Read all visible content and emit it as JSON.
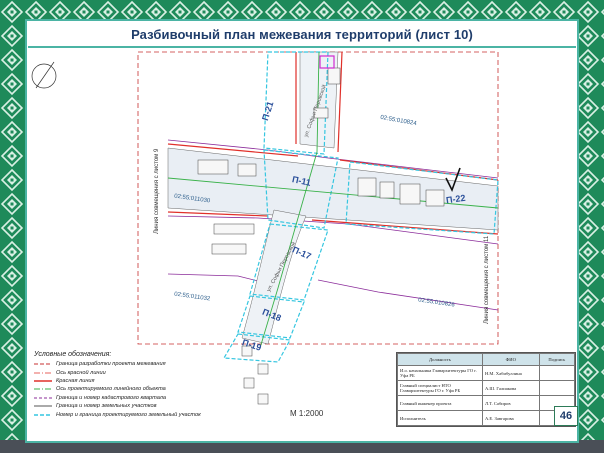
{
  "title": "Разбивочный план межевания территорий (лист 10)",
  "page_number": "46",
  "scale": "М 1:2000",
  "colors": {
    "frame_green": "#1e8a5a",
    "accent_teal": "#4bb4a4",
    "title_text": "#1f3d6b",
    "red_line": "#e0302a",
    "plot_cyan": "#35c6e0",
    "cadastre_purple": "#8b2c9a"
  },
  "side_labels": {
    "left": "Линия совмещения с листом 9",
    "right": "Линия совмещения с листом 11"
  },
  "cadastral_blocks": [
    "02:55:010824",
    "02:55:011030",
    "02:55:011032",
    "02:55:010826"
  ],
  "plots": [
    "П-21",
    "П-11",
    "П-22",
    "П-17",
    "П-18",
    "П-19"
  ],
  "streets": [
    "ул. Софьи Перовской",
    "ул. Софьи Перовской"
  ],
  "legend": {
    "title": "Условные обозначения:",
    "items": [
      "Граница разработки проекта межевания",
      "Ось красной линии",
      "Красная линия",
      "Ось проектируемого линейного объекта",
      "Граница и номер кадастрового квартала",
      "Граница и номер земельных участков",
      "Номер и граница проектируемого земельный участок"
    ]
  },
  "stamp": {
    "headers": [
      "Должность",
      "ФИО",
      "Подпись"
    ],
    "rows": [
      [
        "И.о. начальника Главархитектуры ГО г. Уфа РБ",
        "Н.М. Хабибуллина",
        ""
      ],
      [
        "Главный специалист НТО Главархитектуры ГО г. Уфа РБ",
        "А.Ш. Галиакова",
        ""
      ],
      [
        "Главный инженер проекта",
        "Л.Т. Сабиров",
        ""
      ],
      [
        "Исполнитель",
        "А.Е. Завгарова",
        ""
      ]
    ]
  }
}
